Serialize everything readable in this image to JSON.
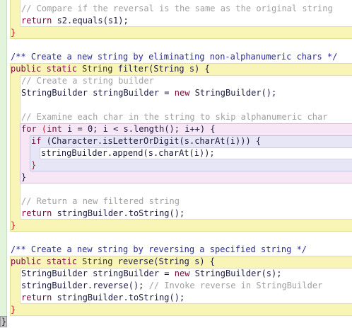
{
  "editor": {
    "lines": [
      {
        "indent": 1,
        "tokens": [
          {
            "t": "// Compare if the reversal is the same as the original string",
            "c": "cm"
          }
        ]
      },
      {
        "indent": 1,
        "tokens": [
          {
            "t": "return",
            "c": "kw"
          },
          {
            "t": " s2.equals(s1);",
            "c": ""
          }
        ]
      },
      {
        "indent": 0,
        "tokens": [
          {
            "t": "}",
            "c": "br"
          }
        ]
      },
      {
        "indent": 0,
        "tokens": []
      },
      {
        "indent": 0,
        "tokens": [
          {
            "t": "/** Create a new string by eliminating non-alphanumeric chars */",
            "c": "jd"
          }
        ]
      },
      {
        "indent": 0,
        "tokens": [
          {
            "t": "public static",
            "c": "kw"
          },
          {
            "t": " String",
            "c": "ty"
          },
          {
            "t": " filter(String s) {",
            "c": ""
          }
        ]
      },
      {
        "indent": 1,
        "tokens": [
          {
            "t": "// Create a string builder",
            "c": "cm"
          }
        ]
      },
      {
        "indent": 1,
        "tokens": [
          {
            "t": "StringBuilder stringBuilder = ",
            "c": ""
          },
          {
            "t": "new",
            "c": "kw"
          },
          {
            "t": " StringBuilder();",
            "c": ""
          }
        ]
      },
      {
        "indent": 1,
        "tokens": []
      },
      {
        "indent": 1,
        "tokens": [
          {
            "t": "// Examine each char in the string to skip alphanumeric char",
            "c": "cm"
          }
        ]
      },
      {
        "indent": 1,
        "tokens": [
          {
            "t": "for",
            "c": "kw"
          },
          {
            "t": " (",
            "c": "br"
          },
          {
            "t": "int",
            "c": "kw"
          },
          {
            "t": " i = 0; i < s.length(); i++) {",
            "c": ""
          }
        ]
      },
      {
        "indent": 2,
        "tokens": [
          {
            "t": "if",
            "c": "kw"
          },
          {
            "t": " (Character.isLetterOrDigit(s.charAt(i))) {",
            "c": ""
          }
        ]
      },
      {
        "indent": 3,
        "tokens": [
          {
            "t": "stringBuilder.append(s.charAt(i));",
            "c": ""
          }
        ]
      },
      {
        "indent": 2,
        "tokens": [
          {
            "t": "}",
            "c": "br"
          }
        ]
      },
      {
        "indent": 1,
        "tokens": [
          {
            "t": "}",
            "c": ""
          }
        ]
      },
      {
        "indent": 1,
        "tokens": []
      },
      {
        "indent": 1,
        "tokens": [
          {
            "t": "// Return a new filtered string",
            "c": "cm"
          }
        ]
      },
      {
        "indent": 1,
        "tokens": [
          {
            "t": "return",
            "c": "kw"
          },
          {
            "t": " stringBuilder.toString();",
            "c": ""
          }
        ]
      },
      {
        "indent": 0,
        "tokens": [
          {
            "t": "}",
            "c": "br"
          }
        ]
      },
      {
        "indent": 0,
        "tokens": []
      },
      {
        "indent": 0,
        "tokens": [
          {
            "t": "/** Create a new string by reversing a specified string */",
            "c": "jd"
          }
        ]
      },
      {
        "indent": 0,
        "tokens": [
          {
            "t": "public static",
            "c": "kw"
          },
          {
            "t": " String",
            "c": "ty"
          },
          {
            "t": " reverse(String s) {",
            "c": ""
          }
        ]
      },
      {
        "indent": 1,
        "tokens": [
          {
            "t": "StringBuilder stringBuilder = ",
            "c": ""
          },
          {
            "t": "new",
            "c": "kw"
          },
          {
            "t": " StringBuilder(s);",
            "c": ""
          }
        ]
      },
      {
        "indent": 1,
        "tokens": [
          {
            "t": "stringBuilder.reverse(); ",
            "c": ""
          },
          {
            "t": "// Invoke reverse in StringBuilder",
            "c": "cm"
          }
        ]
      },
      {
        "indent": 1,
        "tokens": [
          {
            "t": "return",
            "c": "kw"
          },
          {
            "t": " stringBuilder.toString();",
            "c": ""
          }
        ]
      },
      {
        "indent": 0,
        "tokens": [
          {
            "t": "}",
            "c": "br"
          }
        ]
      },
      {
        "indent": -1,
        "tokens": [
          {
            "t": "}",
            "c": ""
          }
        ]
      }
    ]
  }
}
